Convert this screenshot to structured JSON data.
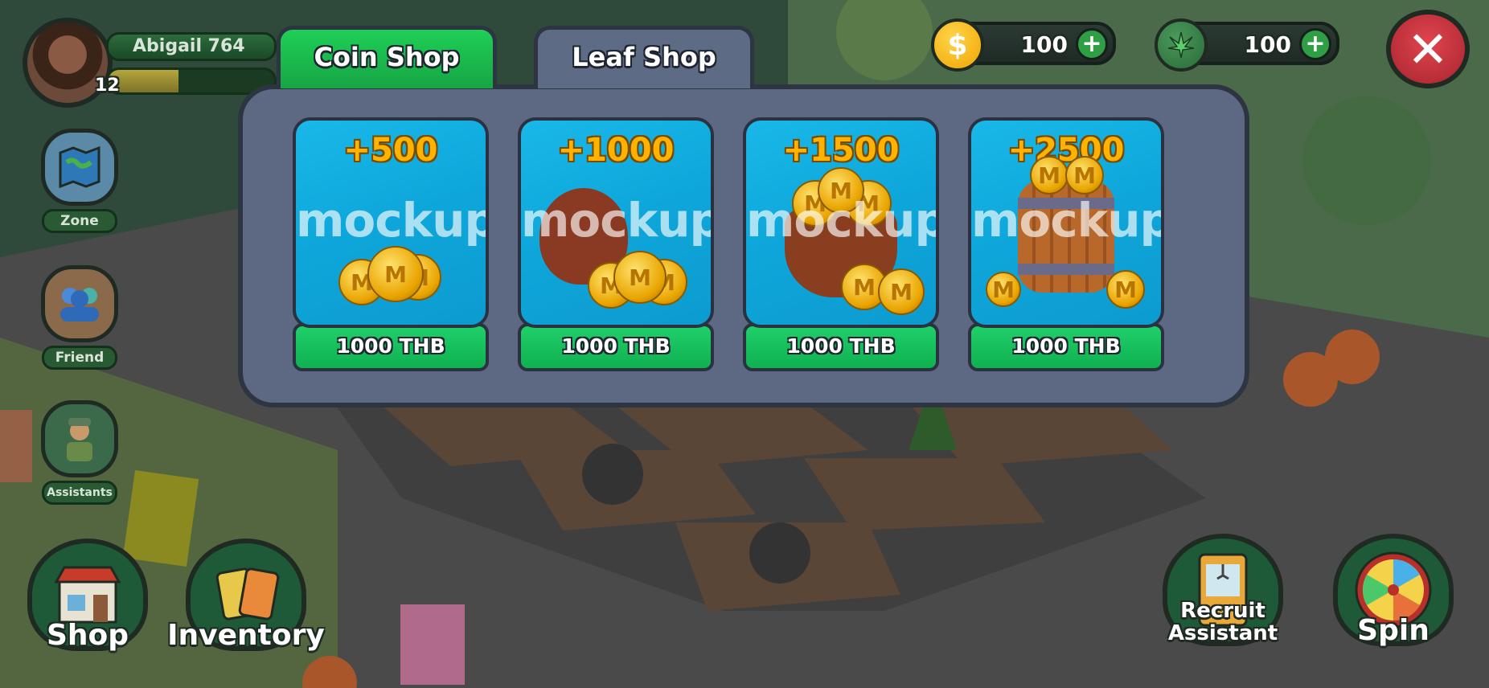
{
  "player": {
    "name": "Abigail 764",
    "level": "12",
    "xp_fraction": 0.42
  },
  "sidebar": {
    "items": [
      {
        "label": "Zone",
        "icon": "map-icon"
      },
      {
        "label": "Friend",
        "icon": "friends-icon"
      },
      {
        "label": "Assistants",
        "icon": "farmer-icon"
      }
    ]
  },
  "bottom_left": {
    "shop_label": "Shop",
    "inventory_label": "Inventory"
  },
  "bottom_right": {
    "recruit_label_line1": "Recruit",
    "recruit_label_line2": "Assistant",
    "spin_label": "Spin"
  },
  "currency": {
    "coins": "100",
    "leaves": "100",
    "coin_symbol": "$",
    "add_symbol": "+"
  },
  "close_symbol": "✕",
  "tabs": [
    {
      "label": "Coin Shop",
      "active": true
    },
    {
      "label": "Leaf Shop",
      "active": false
    }
  ],
  "shop": {
    "items": [
      {
        "amount": "+500",
        "watermark": "mockup",
        "price": "1000 THB",
        "art": "coin-stack"
      },
      {
        "amount": "+1000",
        "watermark": "mockup",
        "price": "1000 THB",
        "art": "coin-sack"
      },
      {
        "amount": "+1500",
        "watermark": "mockup",
        "price": "1000 THB",
        "art": "coin-pot"
      },
      {
        "amount": "+2500",
        "watermark": "mockup",
        "price": "1000 THB",
        "art": "coin-barrel"
      }
    ]
  },
  "colors": {
    "active_tab": "#16a545",
    "panel": "#5d6882",
    "price_button": "#10b050",
    "card_bg": "#0ea6da",
    "close_button": "#c8303a"
  }
}
